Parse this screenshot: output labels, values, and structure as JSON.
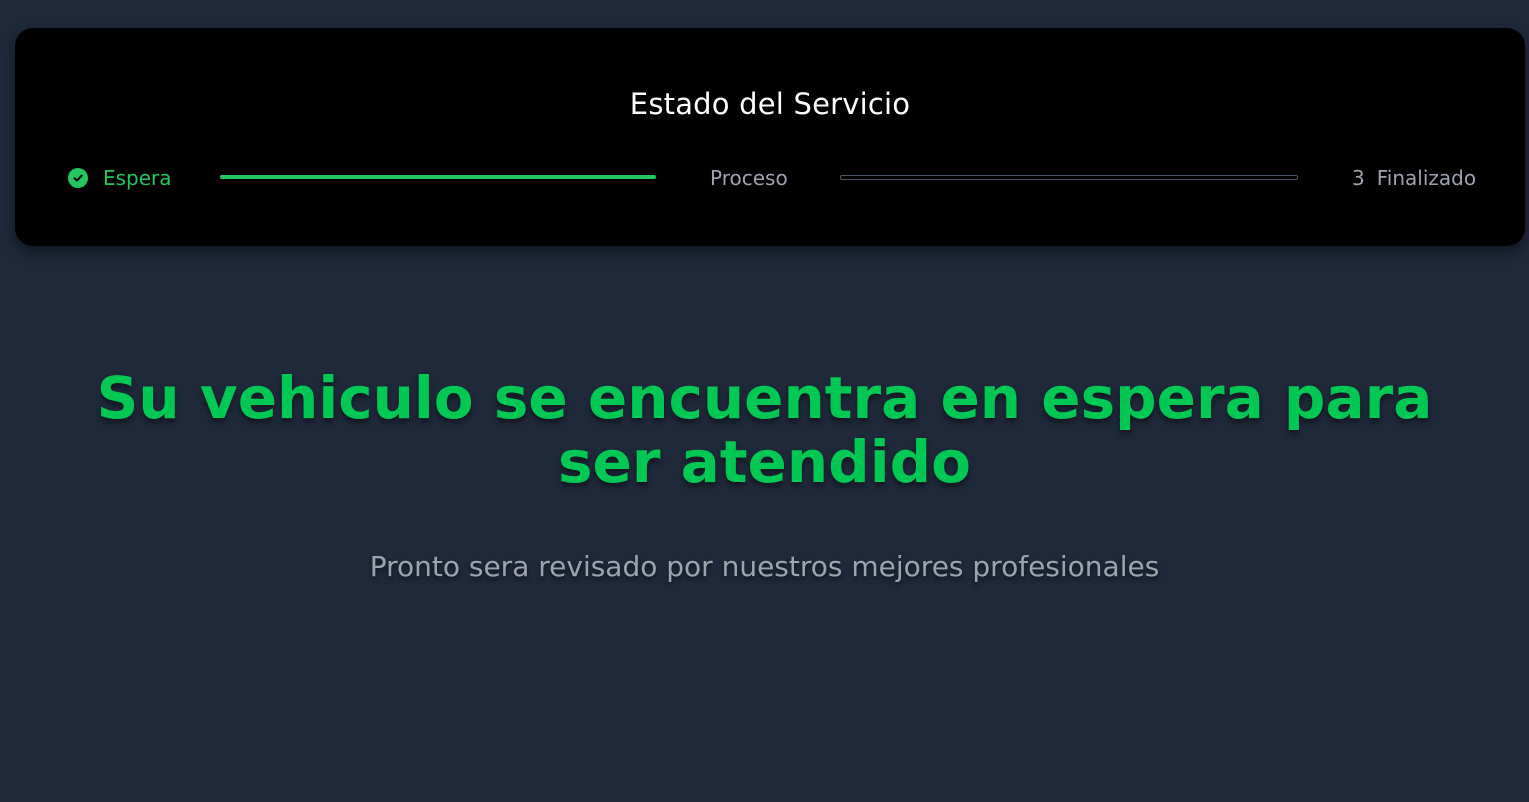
{
  "status_card": {
    "title": "Estado del Servicio",
    "steps": [
      {
        "label": "Espera",
        "state": "completed",
        "icon": "check-circle-icon"
      },
      {
        "label": "Proceso",
        "state": "pending"
      },
      {
        "number": "3",
        "label": "Finalizado",
        "state": "pending"
      }
    ],
    "progress": {
      "completed_connectors": 1,
      "total_connectors": 2
    }
  },
  "main": {
    "headline": "Su vehiculo se encuentra en espera para ser atendido",
    "subheadline": "Pronto sera revisado por nuestros mejores profesionales"
  },
  "colors": {
    "background": "#1f293a",
    "card": "#000000",
    "accent": "#22c55e",
    "headline": "#00c853",
    "muted": "#9ca3af"
  }
}
